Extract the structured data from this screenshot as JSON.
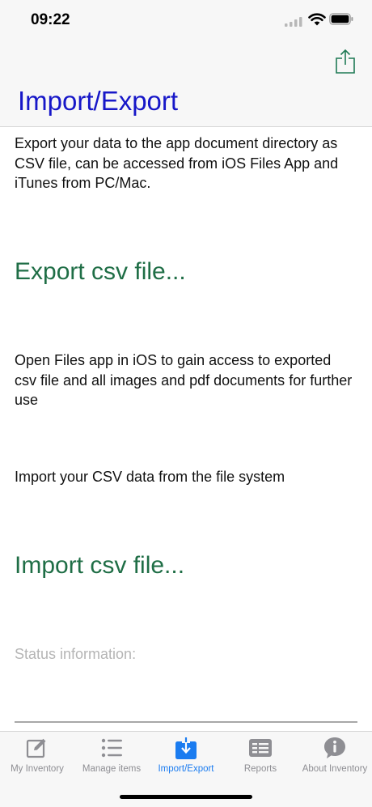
{
  "status_bar": {
    "time": "09:22"
  },
  "nav": {
    "title": "Import/Export"
  },
  "export": {
    "description": "Export your data to the app document directory as CSV file, can be accessed from iOS Files App and iTunes from PC/Mac.",
    "button_label": "Export csv file..."
  },
  "files_info": "Open Files app in iOS to gain access to exported csv file and all images and pdf documents for further use",
  "import": {
    "description": "Import your CSV data from the file system",
    "button_label": "Import csv file..."
  },
  "status": {
    "label": "Status information:"
  },
  "tabs": [
    {
      "label": "My Inventory",
      "icon": "edit-icon"
    },
    {
      "label": "Manage items",
      "icon": "list-icon"
    },
    {
      "label": "Import/Export",
      "icon": "download-icon",
      "active": true
    },
    {
      "label": "Reports",
      "icon": "reports-icon"
    },
    {
      "label": "About Inventory",
      "icon": "info-icon"
    }
  ],
  "colors": {
    "title": "#1717c8",
    "action": "#1f6e46",
    "tab_active": "#1b7cf0",
    "tab_inactive": "#8e8e93"
  }
}
